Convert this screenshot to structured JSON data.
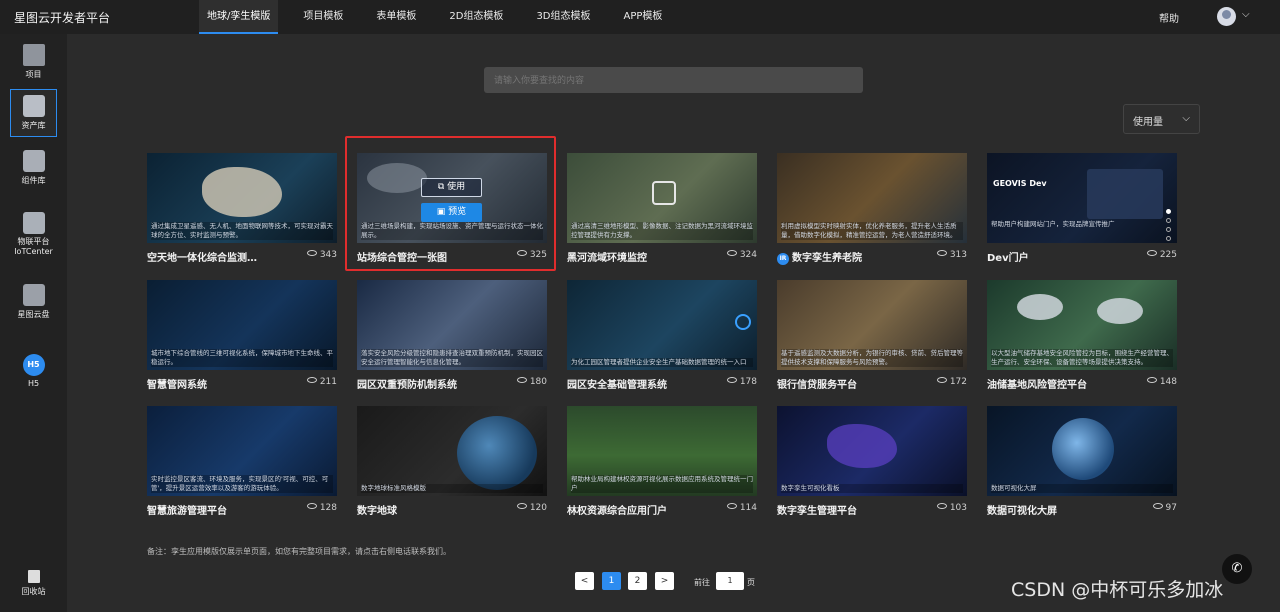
{
  "app": {
    "title": "星图云开发者平台"
  },
  "nav": {
    "items": [
      "地球/孪生模版",
      "项目模板",
      "表单模板",
      "2D组态模板",
      "3D组态模板",
      "APP模板"
    ]
  },
  "header": {
    "help": "帮助"
  },
  "sidebar": {
    "items": [
      {
        "label": "项目",
        "icon": "folder-icon"
      },
      {
        "label": "资产库",
        "icon": "asset-icon"
      },
      {
        "label": "组件库",
        "icon": "component-icon"
      },
      {
        "label": "物联平台 IoTCenter",
        "icon": "iot-icon"
      },
      {
        "label": "星图云盘",
        "icon": "cloud-disk-icon"
      },
      {
        "label": "H5",
        "icon": "h5-icon"
      },
      {
        "label": "回收站",
        "icon": "trash-icon"
      }
    ]
  },
  "search": {
    "placeholder": "请输入你要查找的内容"
  },
  "sort": {
    "label": "使用量"
  },
  "cards": [
    {
      "title": "空天地一体化综合监测…",
      "views": "343",
      "desc": "通过集成卫星遥感、无人机、地面物联网等技术，可实现对霸天球的全方位、实时监测与预警。"
    },
    {
      "title": "站场综合管控一张图",
      "views": "325",
      "desc": "通过三维场景构建，实现站场设施、资产管理与运行状态一体化展示。"
    },
    {
      "title": "黑河流域环境监控",
      "views": "324",
      "desc": "通过高清三维地形模型、影像数据、注记数据为黑河流域环境监控管理提供有力支撑。"
    },
    {
      "title": "数字孪生养老院",
      "views": "313",
      "desc": "利用虚拟模型实时映射实体，优化养老服务，提升老人生活质量，借助数字化模拟，精准管控运营，为老人营造舒适环境。"
    },
    {
      "title": "Dev门户",
      "views": "225",
      "desc": "帮助用户构建网站门户，实现品牌宣传推广"
    },
    {
      "title": "智慧管网系统",
      "views": "211",
      "desc": "城市地下综合管线的三维可视化系统，保障城市地下生命线、平稳运行。"
    },
    {
      "title": "园区双重预防机制系统",
      "views": "180",
      "desc": "落实安全风险分级管控和隐患排查治理双重预防机制，实现园区安全运行管理智能化与信息化管理。"
    },
    {
      "title": "园区安全基础管理系统",
      "views": "178",
      "desc": "为化工园区管理者提供企业安全生产基础数据管理的统一入口"
    },
    {
      "title": "银行信贷服务平台",
      "views": "172",
      "desc": "基于遥感监测及大数据分析，为银行的审核、贷前、贷后管理等提供技术支撑和保障服务与风险预警。"
    },
    {
      "title": "油储基地风险管控平台",
      "views": "148",
      "desc": "以大型油气储存基地安全风险管控为目标，围绕生产经营管理、生产运行、安全环保、设备管控等场景提供决策支持。"
    },
    {
      "title": "智慧旅游管理平台",
      "views": "128",
      "desc": "实时监控景区客流、环境及服务，实现景区的'可视、可控、可管'，提升景区运营效率以及游客的游玩体验。"
    },
    {
      "title": "数字地球",
      "views": "120",
      "desc": "数字地球标准风格模版"
    },
    {
      "title": "林权资源综合应用门户",
      "views": "114",
      "desc": "帮助林业局构建林权资源可视化展示数据应用系统及管理统一门户"
    },
    {
      "title": "数字孪生管理平台",
      "views": "103",
      "desc": "数字孪生可视化看板"
    },
    {
      "title": "数据可视化大屏",
      "views": "97",
      "desc": "数据可视化大屏"
    }
  ],
  "hover": {
    "use": "使用",
    "preview": "预览"
  },
  "note": "备注：孪生应用模版仅展示单页面，如您有完整项目需求，请点击右侧电话联系我们。",
  "pagination": {
    "prev": "<",
    "pages": [
      "1",
      "2"
    ],
    "next": ">",
    "goto_prefix": "前往",
    "goto_value": "1",
    "goto_suffix": "页"
  },
  "watermark": "CSDN @中杯可乐多加冰",
  "colors": {
    "accent": "#2d8cf0",
    "highlight": "#e02d2d",
    "background": "#2b2b2b"
  }
}
